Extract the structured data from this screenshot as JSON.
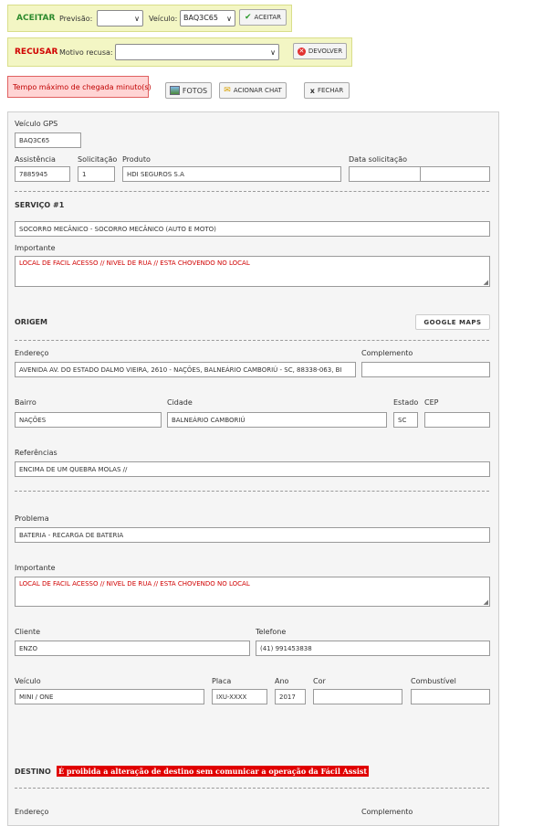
{
  "accept_bar": {
    "title": "ACEITAR",
    "forecast_label": "Previsão:",
    "forecast_value": "",
    "vehicle_label": "Veículo:",
    "vehicle_value": "BAQ3C65",
    "accept_button": "ACEITAR"
  },
  "refuse_bar": {
    "title": "RECUSAR",
    "reason_label": "Motivo recusa:",
    "reason_value": "",
    "return_button": "DEVOLVER"
  },
  "alert": "Tempo máximo de chegada minuto(s)",
  "toolbar": {
    "photos": "FOTOS",
    "chat": "ACIONAR CHAT",
    "close": "FECHAR"
  },
  "form": {
    "vehicle_gps_label": "Veículo GPS",
    "vehicle_gps": "BAQ3C65",
    "assistance_label": "Assistência",
    "assistance": "7885945",
    "request_label": "Solicitação",
    "request": "1",
    "product_label": "Produto",
    "product": "HDI SEGUROS S.A",
    "request_date_label": "Data solicitação",
    "request_date": "",
    "request_time": ""
  },
  "service": {
    "title": "SERVIÇO #1",
    "name": "SOCORRO MECÂNICO - SOCORRO MECÂNICO (AUTO E MOTO)",
    "important_label": "Importante",
    "important": "LOCAL DE FACIL ACESSO // NIVEL DE RUA // ESTA CHOVENDO NO LOCAL"
  },
  "origin": {
    "title": "ORIGEM",
    "maps_button": "GOOGLE MAPS",
    "address_label": "Endereço",
    "address": "AVENIDA AV. DO ESTADO DALMO VIEIRA, 2610 - NAÇÕES, BALNEÁRIO CAMBORIÚ - SC, 88338-063, BI",
    "complement_label": "Complemento",
    "complement": "",
    "district_label": "Bairro",
    "district": "NAÇÕES",
    "city_label": "Cidade",
    "city": "BALNEÁRIO CAMBORIÚ",
    "state_label": "Estado",
    "state": "SC",
    "zip_label": "CEP",
    "zip": "",
    "references_label": "Referências",
    "references": "ENCIMA DE UM QUEBRA MOLAS //"
  },
  "problem": {
    "problem_label": "Problema",
    "problem": "BATERIA - RECARGA DE BATERIA",
    "important_label": "Importante",
    "important": "LOCAL DE FACIL ACESSO // NIVEL DE RUA // ESTA CHOVENDO NO LOCAL",
    "client_label": "Cliente",
    "client": "ENZO",
    "phone_label": "Telefone",
    "phone": "(41) 991453838",
    "vehicle_label": "Veículo",
    "vehicle": "MINI / ONE",
    "plate_label": "Placa",
    "plate": "IXU-XXXX",
    "year_label": "Ano",
    "year": "2017",
    "color_label": "Cor",
    "color": "",
    "fuel_label": "Combustível",
    "fuel": ""
  },
  "destination": {
    "title": "DESTINO",
    "warning": "É proibida a alteração de destino sem comunicar a operação da Fácil Assist",
    "address_label": "Endereço",
    "complement_label": "Complemento"
  }
}
